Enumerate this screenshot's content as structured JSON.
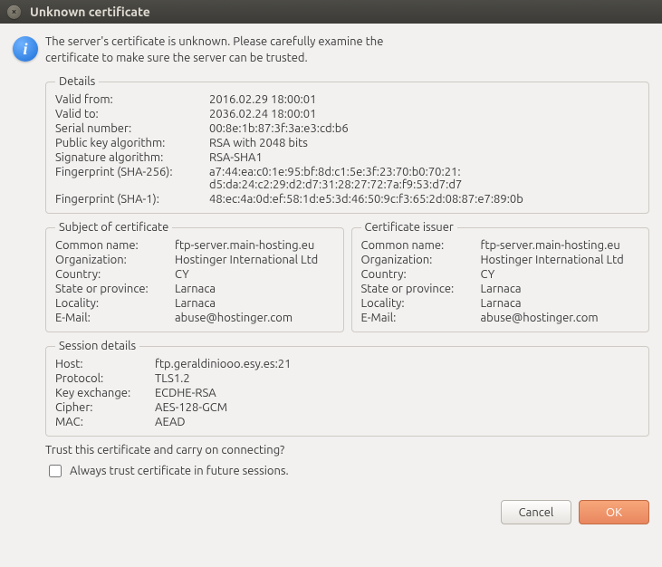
{
  "window": {
    "title": "Unknown certificate"
  },
  "message": "The server's certificate is unknown. Please carefully examine the certificate to make sure the server can be trusted.",
  "details": {
    "legend": "Details",
    "labels": {
      "valid_from": "Valid from:",
      "valid_to": "Valid to:",
      "serial": "Serial number:",
      "pubkey": "Public key algorithm:",
      "sigalg": "Signature algorithm:",
      "fp256": "Fingerprint (SHA-256):",
      "fp1": "Fingerprint (SHA-1):"
    },
    "values": {
      "valid_from": "2016.02.29 18:00:01",
      "valid_to": "2036.02.24 18:00:01",
      "serial": "00:8e:1b:87:3f:3a:e3:cd:b6",
      "pubkey": "RSA with 2048 bits",
      "sigalg": "RSA-SHA1",
      "fp256": "a7:44:ea:c0:1e:95:bf:8d:c1:5e:3f:23:70:b0:70:21:\nd5:da:24:c2:29:d2:d7:31:28:27:72:7a:f9:53:d7:d7",
      "fp1": "48:ec:4a:0d:ef:58:1d:e5:3d:46:50:9c:f3:65:2d:08:87:e7:89:0b"
    }
  },
  "subject": {
    "legend": "Subject of certificate",
    "labels": {
      "cn": "Common name:",
      "org": "Organization:",
      "country": "Country:",
      "state": "State or province:",
      "locality": "Locality:",
      "email": "E-Mail:"
    },
    "values": {
      "cn": "ftp-server.main-hosting.eu",
      "org": "Hostinger International Ltd",
      "country": "CY",
      "state": "Larnaca",
      "locality": "Larnaca",
      "email": "abuse@hostinger.com"
    }
  },
  "issuer": {
    "legend": "Certificate issuer",
    "labels": {
      "cn": "Common name:",
      "org": "Organization:",
      "country": "Country:",
      "state": "State or province:",
      "locality": "Locality:",
      "email": "E-Mail:"
    },
    "values": {
      "cn": "ftp-server.main-hosting.eu",
      "org": "Hostinger International Ltd",
      "country": "CY",
      "state": "Larnaca",
      "locality": "Larnaca",
      "email": "abuse@hostinger.com"
    }
  },
  "session": {
    "legend": "Session details",
    "labels": {
      "host": "Host:",
      "protocol": "Protocol:",
      "kex": "Key exchange:",
      "cipher": "Cipher:",
      "mac": "MAC:"
    },
    "values": {
      "host": "ftp.geraldiniooo.esy.es:21",
      "protocol": "TLS1.2",
      "kex": "ECDHE-RSA",
      "cipher": "AES-128-GCM",
      "mac": "AEAD"
    }
  },
  "question": "Trust this certificate and carry on connecting?",
  "checkbox_label": "Always trust certificate in future sessions.",
  "buttons": {
    "cancel": "Cancel",
    "ok": "OK"
  }
}
